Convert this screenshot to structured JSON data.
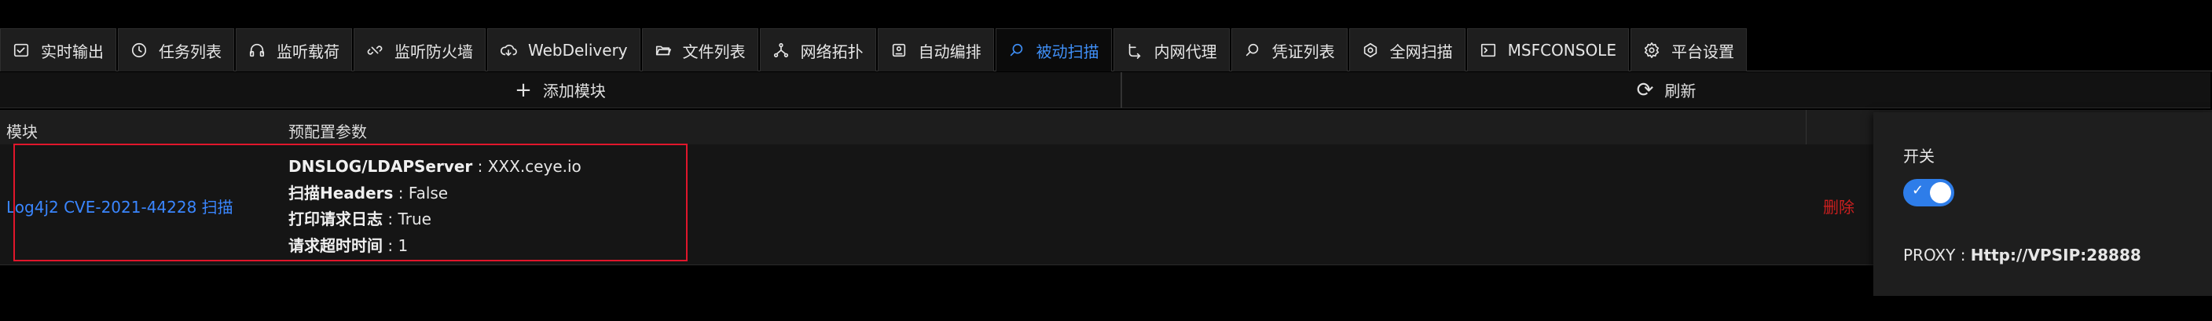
{
  "tabs": [
    {
      "label": "实时输出",
      "icon": "output-icon",
      "active": false
    },
    {
      "label": "任务列表",
      "icon": "clock-icon",
      "active": false
    },
    {
      "label": "监听载荷",
      "icon": "headphones-icon",
      "active": false
    },
    {
      "label": "监听防火墙",
      "icon": "link-broken-icon",
      "active": false
    },
    {
      "label": "WebDelivery",
      "icon": "cloud-download-icon",
      "active": false
    },
    {
      "label": "文件列表",
      "icon": "folder-open-icon",
      "active": false
    },
    {
      "label": "网络拓扑",
      "icon": "network-icon",
      "active": false
    },
    {
      "label": "自动编排",
      "icon": "robot-icon",
      "active": false
    },
    {
      "label": "被动扫描",
      "icon": "search-icon",
      "active": true
    },
    {
      "label": "内网代理",
      "icon": "route-icon",
      "active": false
    },
    {
      "label": "凭证列表",
      "icon": "search-icon",
      "active": false
    },
    {
      "label": "全网扫描",
      "icon": "radar-icon",
      "active": false
    },
    {
      "label": "MSFCONSOLE",
      "icon": "terminal-icon",
      "active": false
    },
    {
      "label": "平台设置",
      "icon": "gear-icon",
      "active": false
    }
  ],
  "actions": {
    "add_label": "添加模块",
    "refresh_label": "刷新"
  },
  "table": {
    "headers": {
      "module": "模块",
      "params": "预配置参数"
    },
    "rows": [
      {
        "module": "Log4j2 CVE-2021-44228 扫描",
        "params": [
          {
            "key": "DNSLOG/LDAPServer",
            "value": " : XXX.ceye.io"
          },
          {
            "key": "扫描Headers",
            "value": " : False"
          },
          {
            "key": "打印请求日志",
            "value": " : True"
          },
          {
            "key": "请求超时时间",
            "value": " : 1"
          }
        ],
        "delete_label": "删除"
      }
    ]
  },
  "popover": {
    "switch_label": "开关",
    "switch_on": true,
    "proxy_label": "PROXY : ",
    "proxy_value": "Http://VPSIP:28888"
  },
  "colors": {
    "accent": "#3f8ff7",
    "danger": "#cc1f1f",
    "highlight": "#e0162b"
  }
}
